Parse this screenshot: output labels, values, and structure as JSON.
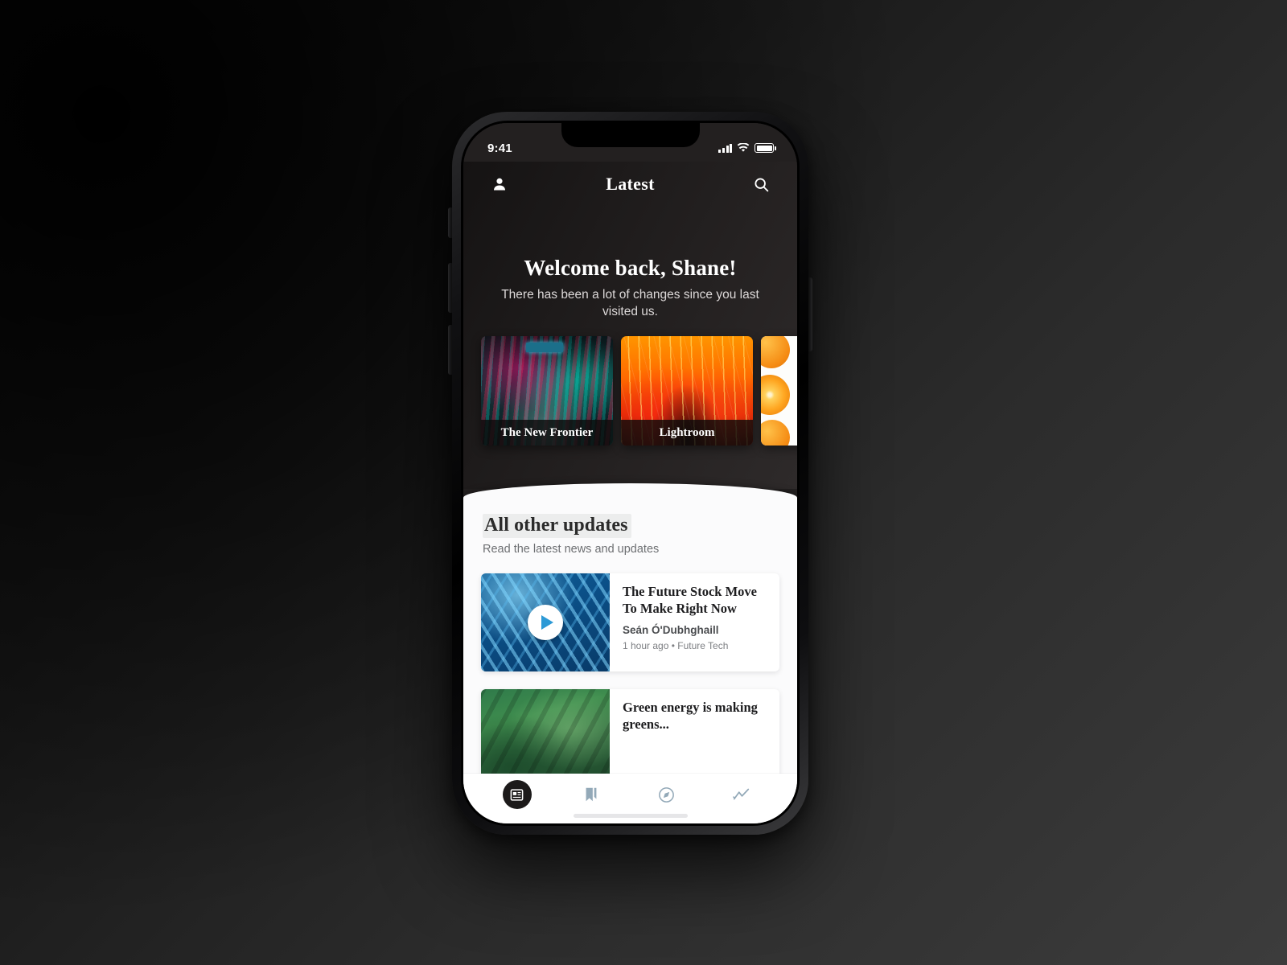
{
  "status_bar": {
    "time": "9:41",
    "signal_icon": "cellular-bars-icon",
    "wifi_icon": "wifi-icon",
    "battery_icon": "battery-full-icon"
  },
  "nav": {
    "title": "Latest",
    "profile_icon": "person-icon",
    "search_icon": "search-icon"
  },
  "welcome": {
    "title": "Welcome back, Shane!",
    "subtitle": "There has been a lot of changes since you last visited us."
  },
  "stories": [
    {
      "label": "The New Frontier",
      "art": "neon-city"
    },
    {
      "label": "Lightroom",
      "art": "concert-stage"
    },
    {
      "label": "",
      "art": "oranges"
    }
  ],
  "section": {
    "title": "All other updates",
    "subtitle": "Read the latest news and updates"
  },
  "news": [
    {
      "title": "The Future Stock Move To Make Right Now",
      "author": "Seán Ó'Dubhghaill",
      "meta": "1 hour ago • Future Tech",
      "thumb": "dna-helix",
      "has_play": true
    },
    {
      "title": "Green energy is making greens...",
      "author": "",
      "meta": "",
      "thumb": "green-hills",
      "has_play": false
    }
  ],
  "tabs": [
    {
      "name": "news",
      "icon": "news-article-icon",
      "active": true
    },
    {
      "name": "bookmarks",
      "icon": "bookmark-icon",
      "active": false
    },
    {
      "name": "explore",
      "icon": "compass-icon",
      "active": false
    },
    {
      "name": "trending",
      "icon": "trending-line-icon",
      "active": false
    }
  ],
  "colors": {
    "hero_bg": "#201d1d",
    "panel_bg": "#fbfbfc",
    "accent_blue": "#2d9ad6",
    "tab_active_bg": "#1c1a1a",
    "tab_inactive": "#9fb3bf"
  }
}
